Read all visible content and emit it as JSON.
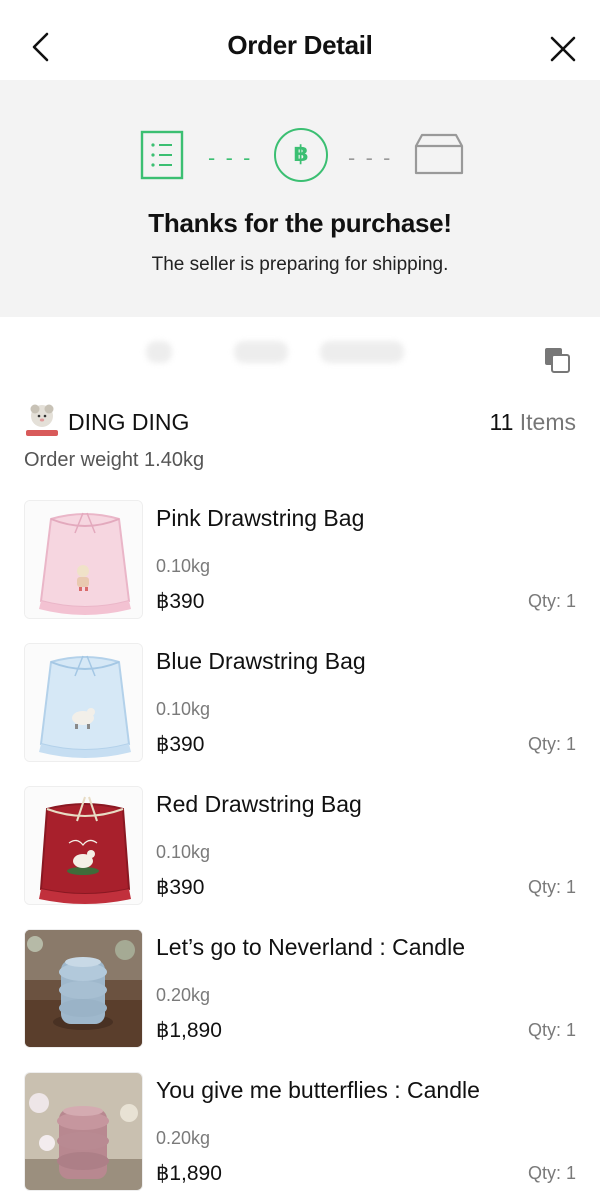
{
  "header": {
    "title": "Order Detail"
  },
  "status": {
    "steps": [
      "order-placed",
      "payment",
      "shipping"
    ],
    "currency_symbol": "฿",
    "dash": "- - -",
    "title": "Thanks for the purchase!",
    "subtitle": "The seller is preparing for shipping.",
    "colors": {
      "active": "#3bbf72",
      "inactive": "#999999"
    }
  },
  "shop": {
    "name": "DING DING",
    "item_count": "11",
    "item_label": " Items",
    "order_weight": "Order weight 1.40kg"
  },
  "products": [
    {
      "name": "Pink Drawstring Bag",
      "weight": "0.10kg",
      "price": "฿390",
      "qty": "Qty: 1",
      "thumb": "pink-bag"
    },
    {
      "name": "Blue Drawstring Bag",
      "weight": "0.10kg",
      "price": "฿390",
      "qty": "Qty: 1",
      "thumb": "blue-bag"
    },
    {
      "name": "Red Drawstring Bag",
      "weight": "0.10kg",
      "price": "฿390",
      "qty": "Qty: 1",
      "thumb": "red-bag"
    },
    {
      "name": "Let’s go to Neverland : Candle",
      "weight": "0.20kg",
      "price": "฿1,890",
      "qty": "Qty: 1",
      "thumb": "blue-candle"
    },
    {
      "name": "You give me butterflies : Candle",
      "weight": "0.20kg",
      "price": "฿1,890",
      "qty": "Qty: 1",
      "thumb": "pink-candle"
    }
  ]
}
